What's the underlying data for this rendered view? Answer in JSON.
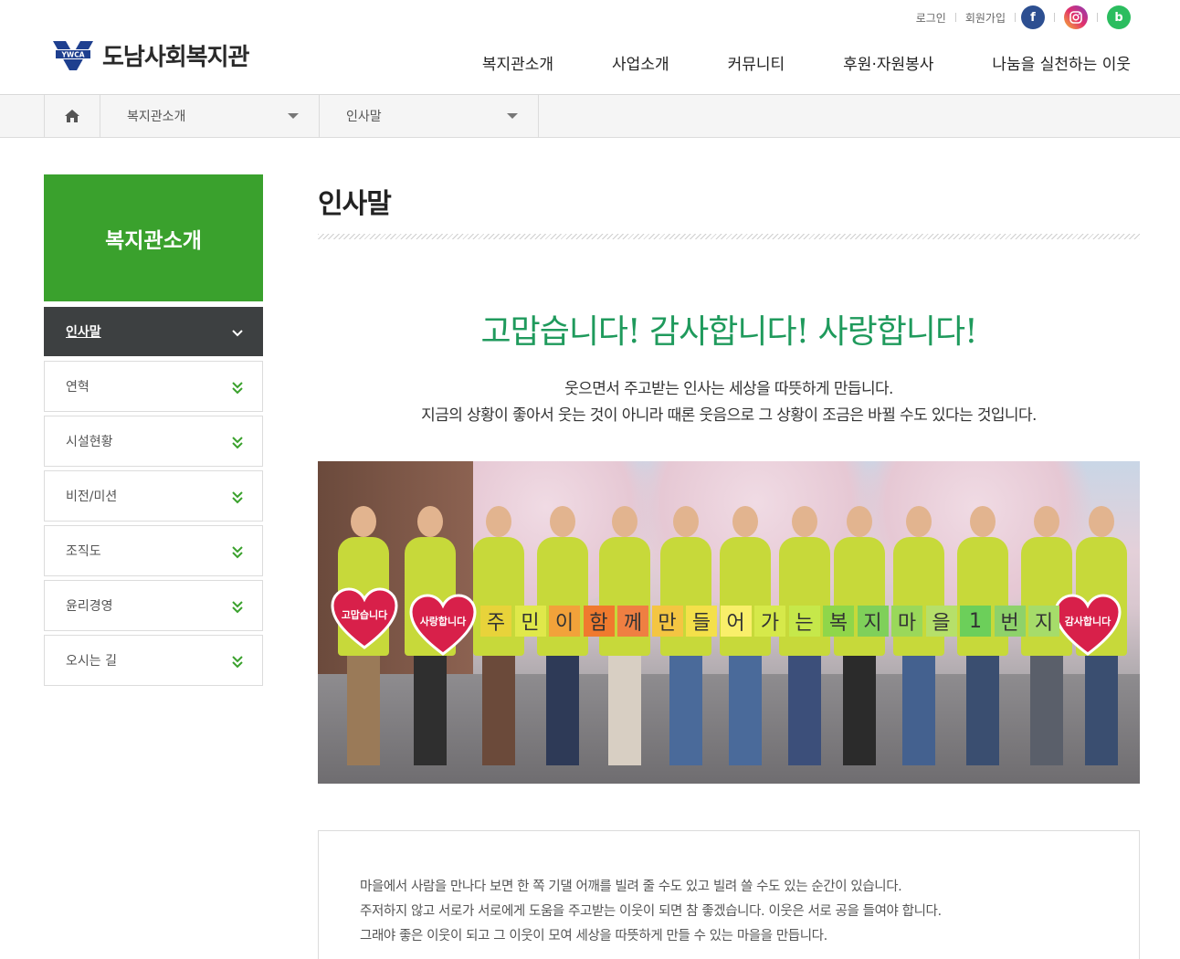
{
  "site": {
    "logo_mark": "YWCA",
    "name": "도남사회복지관"
  },
  "util": {
    "login": "로그인",
    "join": "회원가입",
    "sns": [
      "facebook-icon",
      "instagram-icon",
      "band-icon"
    ]
  },
  "gnb": [
    "복지관소개",
    "사업소개",
    "커뮤니티",
    "후원·자원봉사",
    "나눔을 실천하는 이웃"
  ],
  "breadcrumb": {
    "level1": "복지관소개",
    "level2": "인사말"
  },
  "lnb": {
    "title": "복지관소개",
    "items": [
      "인사말",
      "연혁",
      "시설현황",
      "비전/미션",
      "조직도",
      "윤리경영",
      "오시는 길"
    ],
    "active_index": 0
  },
  "content": {
    "title": "인사말",
    "headline": "고맙습니다! 감사합니다! 사랑합니다!",
    "sub1": "웃으면서 주고받는 인사는 세상을 따뜻하게 만듭니다.",
    "sub2": "지금의 상황이 좋아서 웃는 것이 아니라 때론 웃음으로 그 상황이 조금은 바뀔 수도 있다는 것입니다.",
    "photo": {
      "heart_left_1": "고맙습니다",
      "heart_left_2": "사랑합니다",
      "heart_right": "감사합니다",
      "cards": [
        "주",
        "민",
        "이",
        "함",
        "께",
        "만",
        "들",
        "어",
        "가",
        "는",
        "복",
        "지",
        "마",
        "을",
        "1",
        "번",
        "지"
      ]
    },
    "paragraph": [
      "마을에서 사람을 만나다 보면 한 쪽 기댈 어깨를 빌려 줄 수도 있고 빌려 쓸 수도 있는 순간이 있습니다.",
      "주저하지 않고 서로가 서로에게 도움을 주고받는 이웃이 되면 참 좋겠습니다. 이웃은 서로 공을 들여야 합니다.",
      "그래야 좋은 이웃이 되고 그 이웃이 모여 세상을 따뜻하게 만들 수 있는 마을을 만듭니다."
    ]
  },
  "colors": {
    "brand_green": "#3aa12d",
    "headline_green": "#1f9a5c",
    "active_menu": "#3d4041"
  }
}
